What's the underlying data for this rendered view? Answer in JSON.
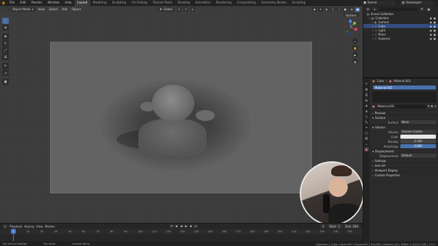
{
  "topbar": {
    "menus": [
      "File",
      "Edit",
      "Render",
      "Window",
      "Help"
    ],
    "workspaces": [
      "Layout",
      "Modeling",
      "Sculpting",
      "UV Editing",
      "Texture Paint",
      "Shading",
      "Animation",
      "Rendering",
      "Compositing",
      "Geometry Nodes",
      "Scripting"
    ],
    "active_workspace": "Layout",
    "scene": "Scene",
    "view_layer": "ViewLayer"
  },
  "viewport": {
    "mode": "Object Mode",
    "menus": [
      "View",
      "Select",
      "Add",
      "Object"
    ],
    "orientation": "Global",
    "options": "Options"
  },
  "timeline": {
    "menus": [
      "Playback",
      "Keying",
      "View",
      "Marker"
    ],
    "current_frame": "1",
    "start_label": "Start",
    "start": "1",
    "end_label": "End",
    "end": "250",
    "ticks": [
      "1",
      "20",
      "30",
      "40",
      "50",
      "60",
      "70",
      "80",
      "90",
      "100",
      "110",
      "120",
      "130",
      "140",
      "150",
      "160",
      "170",
      "180",
      "190",
      "200",
      "210",
      "220",
      "230",
      "240",
      "250"
    ]
  },
  "statusbar": {
    "left": "Set Active Modifier",
    "mid1": "Pan View",
    "mid2": "Context Menu",
    "right": "Collection | Cube | Verts:507 | Faces:507 | Tris:993 | Objects:1/5 | VRAM: 0.3/24.0 GiB | 3.3.1"
  },
  "outliner": {
    "items": [
      {
        "name": "Scene Collection",
        "icon": "collection-icon",
        "level": 0
      },
      {
        "name": "Collection",
        "icon": "collection-icon",
        "level": 1
      },
      {
        "name": "Camera",
        "icon": "camera-icon",
        "level": 2
      },
      {
        "name": "Cube",
        "icon": "mesh-icon",
        "level": 2,
        "selected": true
      },
      {
        "name": "Light",
        "icon": "light-icon",
        "level": 2
      },
      {
        "name": "Plane",
        "icon": "mesh-icon",
        "level": 2
      },
      {
        "name": "Suzanne",
        "icon": "mesh-icon",
        "level": 2
      }
    ]
  },
  "properties": {
    "crumb_object": "Cube",
    "crumb_material": "Material.001",
    "slot": "Material.001",
    "material": "Material.001",
    "sections": {
      "preview": "Preview",
      "surface": "Surface",
      "volume": "Volume",
      "displacement": "Displacement",
      "settings": "Settings",
      "line_art": "Line Art",
      "viewport_display": "Viewport Display",
      "custom_properties": "Custom Properties"
    },
    "surface_label": "Surface",
    "surface_value": "None",
    "volume_label": "Volume",
    "volume_value": "Volume Scatter",
    "color_label": "Color",
    "density_label": "Density",
    "density_value": "0.100",
    "anisotropy_label": "Anisotropy",
    "anisotropy_value": "0.000",
    "displacement_label": "Displacement",
    "displacement_value": "Default"
  },
  "colors": {
    "accent": "#4a72b0",
    "selected_row": "#334d80",
    "blender_orange": "#e87d0d"
  }
}
